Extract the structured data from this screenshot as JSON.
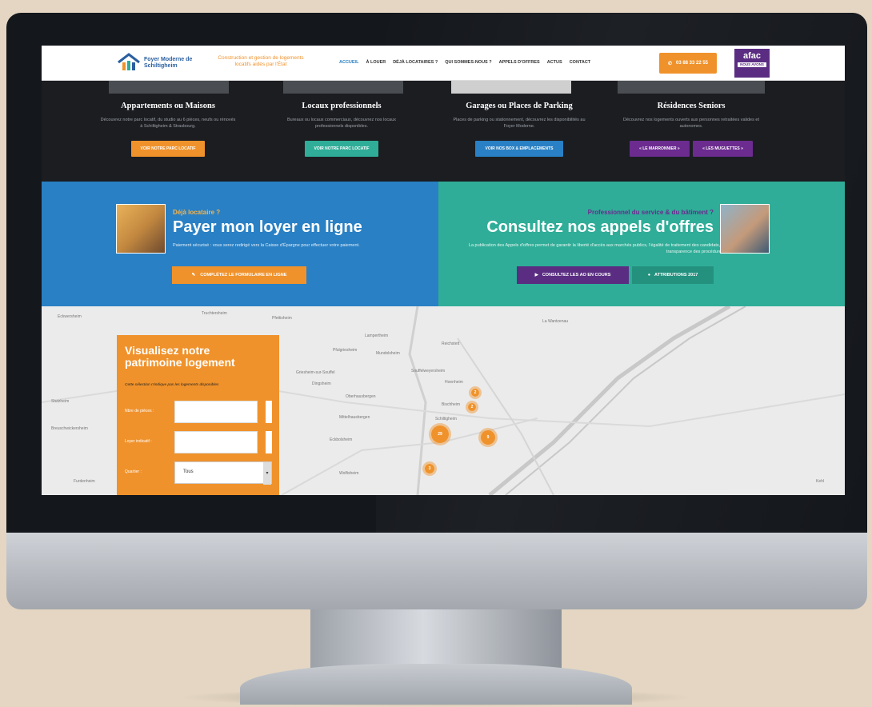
{
  "header": {
    "logo_text": "Foyer Moderne de Schiltigheim",
    "tagline": "Construction et gestion de logements locatifs aidés par l'État",
    "nav": [
      "ACCUEIL",
      "À LOUER",
      "DÉJÀ LOCATAIRES ?",
      "QUI SOMMES-NOUS ?",
      "APPELS D'OFFRES",
      "ACTUS",
      "CONTACT"
    ],
    "phone": "03 88 33 22 55",
    "badge_title": "afac",
    "badge_sub": "NOUS AVONS"
  },
  "columns": [
    {
      "title": "Appartements ou Maisons",
      "text": "Découvrez notre parc locatif, du studio au 6 pièces, neufs ou rénovés à Schiltigheim & Strasbourg.",
      "buttons": [
        "VOIR NOTRE PARC LOCATIF"
      ],
      "color": "#f0922b"
    },
    {
      "title": "Locaux professionnels",
      "text": "Bureaux ou locaux commerciaux, découvrez nos locaux professionnels disponibles.",
      "buttons": [
        "VOIR NOTRE PARC LOCATIF"
      ],
      "color": "#2fad98"
    },
    {
      "title": "Garages ou Places de Parking",
      "text": "Places de parking ou stationnement, découvrez les disponibilités au Foyer Moderne.",
      "buttons": [
        "VOIR NOS BOX & EMPLACEMENTS"
      ],
      "color": "#2980c4"
    },
    {
      "title": "Résidences Seniors",
      "text": "Découvrez nos logements ouverts aux personnes retraitées valides et autonomes.",
      "buttons": [
        "« LE MARRONNIER »",
        "« LES MUGUETTES »"
      ],
      "color": "#6b2b8f"
    }
  ],
  "promo_left": {
    "eyebrow": "Déjà locataire ?",
    "title": "Payer mon loyer en ligne",
    "text": "Paiement sécurisé : vous serez redirigé vers la Caisse d'Épargne pour effectuer votre paiement.",
    "button": "COMPLÉTEZ LE FORMULAIRE EN LIGNE"
  },
  "promo_right": {
    "eyebrow": "Professionnel du service & du bâtiment ?",
    "title": "Consultez nos appels d'offres",
    "text": "La publication des Appels d'offres permet de garantir la liberté d'accès aux marchés publics, l'égalité de traitement des candidats, la transparence des procédures.",
    "button1": "CONSULTEZ LES AO EN COURS",
    "button2": "ATTRIBUTIONS 2017"
  },
  "map": {
    "labels": [
      "Truchtersheim",
      "Pfettisheim",
      "Lampertheim",
      "Reichstett",
      "Mundolsheim",
      "Pfulgriesheim",
      "Oberhausbergen",
      "Mittelhausbergen",
      "Bischheim",
      "Hoenheim",
      "Souffelweyersheim",
      "Schiltigheim",
      "Wolfisheim",
      "Eckbolsheim",
      "La Wantzenau",
      "Kehl",
      "Eckwersheim",
      "Griesheim-sur-Souffel",
      "Dingsheim",
      "Stutzheim",
      "Breuschwickersheim",
      "Furdenheim"
    ],
    "markers": [
      "2",
      "2",
      "29",
      "9",
      "3"
    ],
    "search": {
      "title": "Visualisez notre patrimoine logement",
      "note": "Cette sélection n'indique pas les logements disponibles",
      "fields": [
        {
          "label": "Nbre de pièces :",
          "value": ""
        },
        {
          "label": "Loyer indicatif :",
          "value": ""
        },
        {
          "label": "Quartier :",
          "value": "Tous"
        }
      ]
    }
  }
}
